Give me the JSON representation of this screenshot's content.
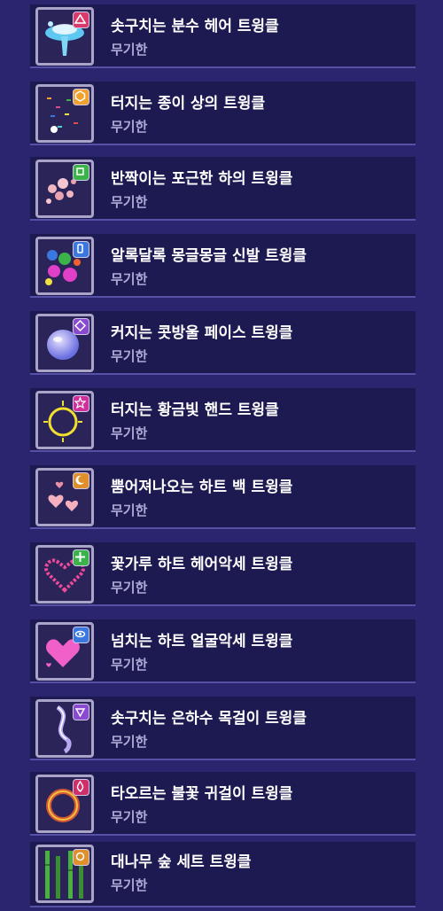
{
  "items": [
    {
      "title": "솟구치는 분수 헤어 트윙클",
      "duration": "무기한",
      "icon": "fountain-icon",
      "badge_icon": "triangle-badge-icon",
      "accent": "#5ec8f0",
      "badge_color": "#d93a6b"
    },
    {
      "title": "터지는 종이 상의 트윙클",
      "duration": "무기한",
      "icon": "confetti-icon",
      "badge_icon": "hexagon-badge-icon",
      "accent": "#e8883a",
      "badge_color": "#f2a12f"
    },
    {
      "title": "반짝이는 포근한 하의 트윙클",
      "duration": "무기한",
      "icon": "bubbles-icon",
      "badge_icon": "square-badge-icon",
      "accent": "#f0b6c0",
      "badge_color": "#3bb34a"
    },
    {
      "title": "알록달록 몽글몽글 신발 트윙클",
      "duration": "무기한",
      "icon": "colorful-dots-icon",
      "badge_icon": "shoe-badge-icon",
      "accent": "#e040c8",
      "badge_color": "#3a78e0"
    },
    {
      "title": "커지는 콧방울 페이스 트윙클",
      "duration": "무기한",
      "icon": "bubble-icon",
      "badge_icon": "diamond-badge-icon",
      "accent": "#9aa0f0",
      "badge_color": "#8a4ad0"
    },
    {
      "title": "터지는 황금빛 핸드 트윙클",
      "duration": "무기한",
      "icon": "golden-ring-icon",
      "badge_icon": "star-badge-icon",
      "accent": "#f2e030",
      "badge_color": "#d0309a"
    },
    {
      "title": "뿜어져나오는 하트 백 트윙클",
      "duration": "무기한",
      "icon": "hearts-icon",
      "badge_icon": "moon-badge-icon",
      "accent": "#f5b0c0",
      "badge_color": "#e0902a"
    },
    {
      "title": "꽃가루 하트 헤어악세 트윙클",
      "duration": "무기한",
      "icon": "heart-wreath-icon",
      "badge_icon": "clover-badge-icon",
      "accent": "#f04a9a",
      "badge_color": "#3bb34a"
    },
    {
      "title": "넘치는 하트 얼굴악세 트윙클",
      "duration": "무기한",
      "icon": "big-heart-icon",
      "badge_icon": "eye-badge-icon",
      "accent": "#f060c8",
      "badge_color": "#3a78e0"
    },
    {
      "title": "솟구치는 은하수 목걸이 트윙클",
      "duration": "무기한",
      "icon": "galaxy-swirl-icon",
      "badge_icon": "gem-badge-icon",
      "accent": "#b8a8f0",
      "badge_color": "#8a4ad0"
    },
    {
      "title": "타오르는 불꽃 귀걸이 트윙클",
      "duration": "무기한",
      "icon": "fire-ring-icon",
      "badge_icon": "drop-badge-icon",
      "accent": "#f06030",
      "badge_color": "#d0306a"
    },
    {
      "title": "대나무 숲 세트 트윙클",
      "duration": "무기한",
      "icon": "bamboo-icon",
      "badge_icon": "orb-badge-icon",
      "accent": "#4ab040",
      "badge_color": "#e0902a"
    }
  ]
}
